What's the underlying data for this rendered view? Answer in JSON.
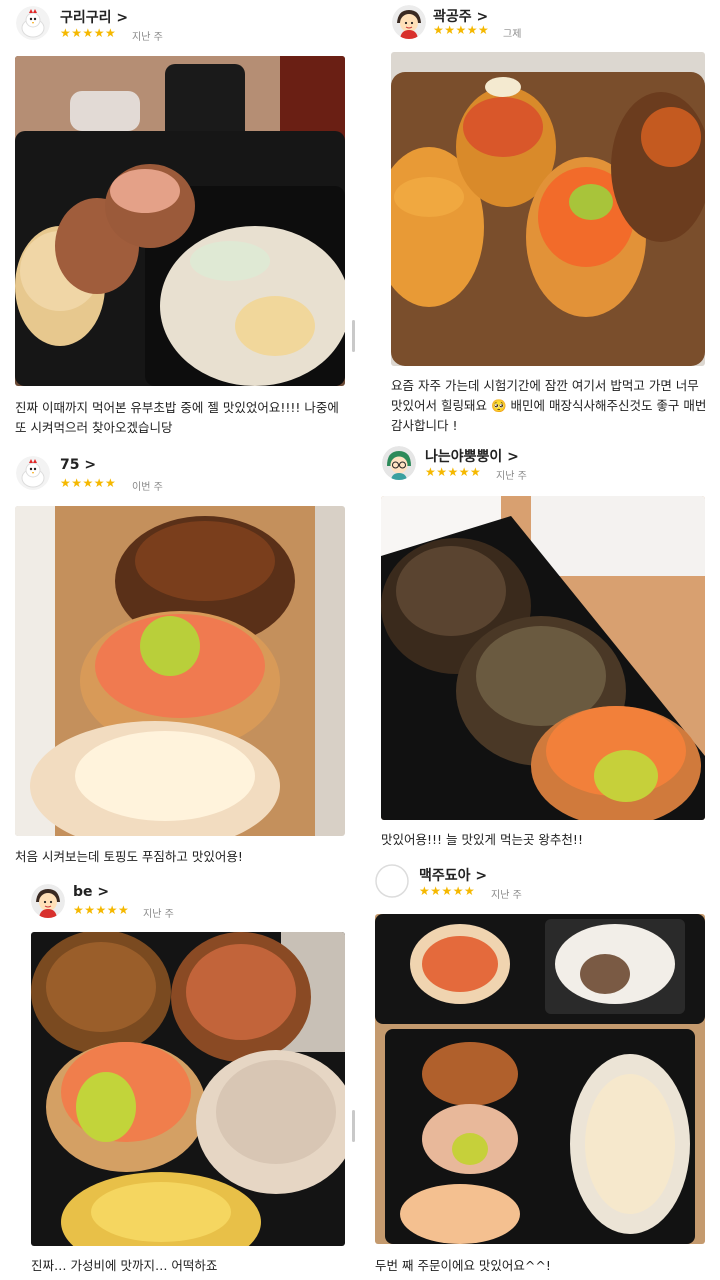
{
  "reviews": [
    {
      "name": "구리구리",
      "stars": "★★★★★",
      "when": "지난 주",
      "avatar": "chicken-mascot",
      "text": "진짜 이때까지 먹어본 유부초밥 중에 젤 맛있었어요!!!! 나중에 또 시켜먹으러 찾아오겠습니당"
    },
    {
      "name": "곽공주",
      "stars": "★★★★★",
      "when": "그제",
      "avatar": "cartoon-girl-red",
      "text": "요즘 자주 가는데 시험기간에 잠깐 여기서 밥먹고 가면 너무 맛있어서 힐링돼요 🥺 배민에 매장식사해주신것도 좋구 매번 감사합니다 !"
    },
    {
      "name": "75",
      "stars": "★★★★★",
      "when": "이번 주",
      "avatar": "chicken-mascot",
      "text": "처음 시켜보는데 토핑도 푸짐하고 맛있어용!"
    },
    {
      "name": "나는야뿡뿡이",
      "stars": "★★★★★",
      "when": "지난 주",
      "avatar": "cartoon-green-hair",
      "text": "맛있어용!!! 늘 맛있게 먹는곳 왕추천!!"
    },
    {
      "name": "be",
      "stars": "★★★★★",
      "when": "지난 주",
      "avatar": "cartoon-girl-red",
      "text": "진짜… 가성비에 맛까지… 어떡하죠"
    },
    {
      "name": "맥주됴아",
      "stars": "★★★★★",
      "when": "지난 주",
      "avatar": "empty-avatar",
      "text": "두번 째 주문이에요 맛있어요^^!"
    }
  ],
  "name_suffix": ">"
}
